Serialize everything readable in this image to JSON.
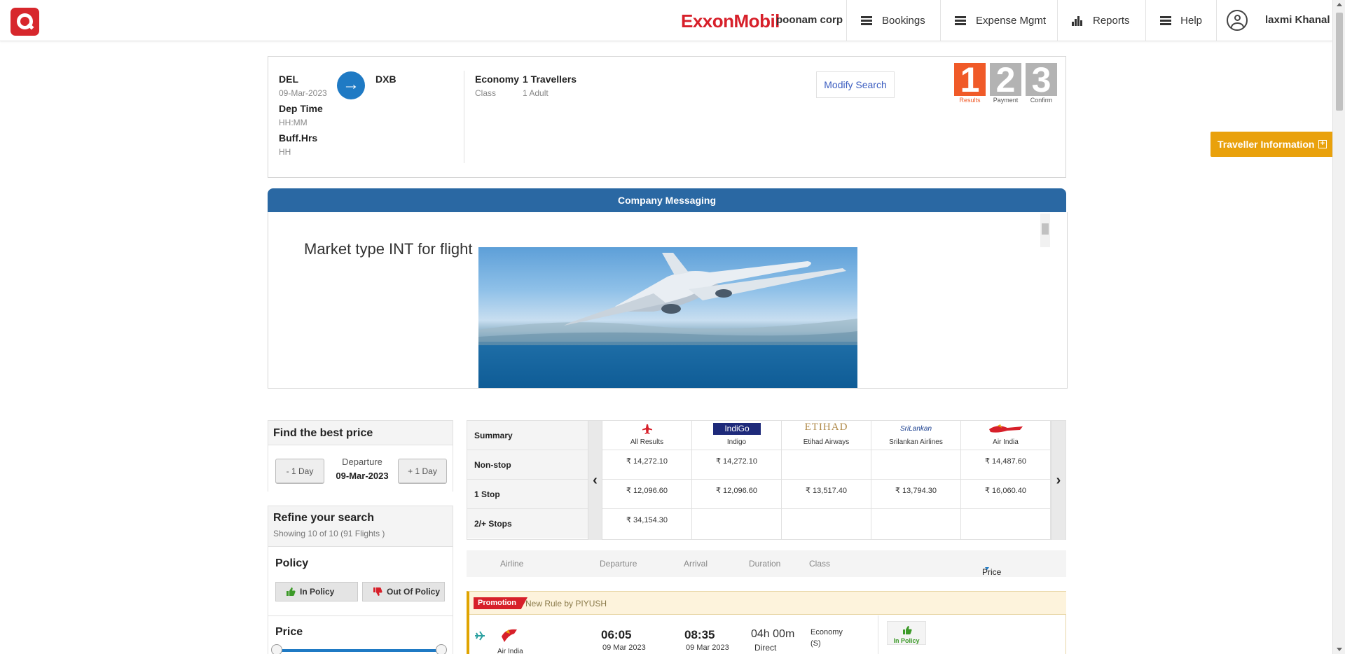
{
  "header": {
    "brand": "ExxonMobil",
    "company": "poonam corp",
    "nav": [
      {
        "label": "Bookings",
        "icon": "hamburger-icon"
      },
      {
        "label": "Expense Mgmt",
        "icon": "hamburger-icon"
      },
      {
        "label": "Reports",
        "icon": "bar-chart-icon"
      },
      {
        "label": "Help",
        "icon": "hamburger-icon"
      }
    ],
    "user": "laxmi Khanal"
  },
  "search": {
    "from": "DEL",
    "to": "DXB",
    "date": "09-Mar-2023",
    "dep_time_label": "Dep Time",
    "dep_time_value": "HH:MM",
    "buff_label": "Buff.Hrs",
    "buff_value": "HH",
    "class_label": "Economy",
    "class_sub": "Class",
    "travellers_label": "1 Travellers",
    "travellers_sub": "1 Adult",
    "modify": "Modify Search"
  },
  "steps": [
    {
      "num": "1",
      "label": "Results",
      "color": "#f05a28"
    },
    {
      "num": "2",
      "label": "Payment",
      "color": "#b3b3b3"
    },
    {
      "num": "3",
      "label": "Confirm",
      "color": "#b3b3b3"
    }
  ],
  "traveller_info": "Traveller Information",
  "messaging": {
    "title": "Company Messaging",
    "text": "Market type INT for flight"
  },
  "best_price": {
    "title": "Find the best price",
    "minus": "- 1 Day",
    "plus": "+ 1 Day",
    "dep_label": "Departure",
    "dep_date": "09-Mar-2023"
  },
  "refine": {
    "title": "Refine your search",
    "showing": "Showing 10 of 10 (91 Flights )"
  },
  "policy": {
    "title": "Policy",
    "in": "In Policy",
    "out": "Out Of Policy"
  },
  "price_filter": {
    "title": "Price"
  },
  "matrix": {
    "rows": [
      "Summary",
      "Non-stop",
      "1 Stop",
      "2/+ Stops"
    ],
    "columns": [
      {
        "name": "All Results",
        "logo": "airplane-red-icon",
        "cells": [
          "₹ 14,272.10",
          "₹ 12,096.60",
          "₹ 34,154.30"
        ]
      },
      {
        "name": "Indigo",
        "logo": "IndiGo",
        "cells": [
          "₹ 14,272.10",
          "₹ 12,096.60",
          ""
        ]
      },
      {
        "name": "Etihad Airways",
        "logo": "ETIHAD",
        "cells": [
          "",
          "₹ 13,517.40",
          ""
        ]
      },
      {
        "name": "Srilankan Airlines",
        "logo": "SriLankan",
        "cells": [
          "",
          "₹ 13,794.30",
          ""
        ]
      },
      {
        "name": "Air India",
        "logo": "air-india-icon",
        "cells": [
          "₹ 14,487.60",
          "₹ 16,060.40",
          ""
        ]
      }
    ]
  },
  "results_header": {
    "airline": "Airline",
    "departure": "Departure",
    "arrival": "Arrival",
    "duration": "Duration",
    "class": "Class",
    "price": "Price"
  },
  "result": {
    "promo_tag": "Promotion",
    "promo_text": "New Rule by PIYUSH",
    "airline": "Air India",
    "dep_time": "06:05",
    "dep_date": "09 Mar 2023",
    "arr_time": "08:35",
    "arr_date": "09 Mar 2023",
    "duration": "04h 00m",
    "stops": "Direct",
    "class": "Economy",
    "class_code": "(S)",
    "policy": "In Policy"
  }
}
